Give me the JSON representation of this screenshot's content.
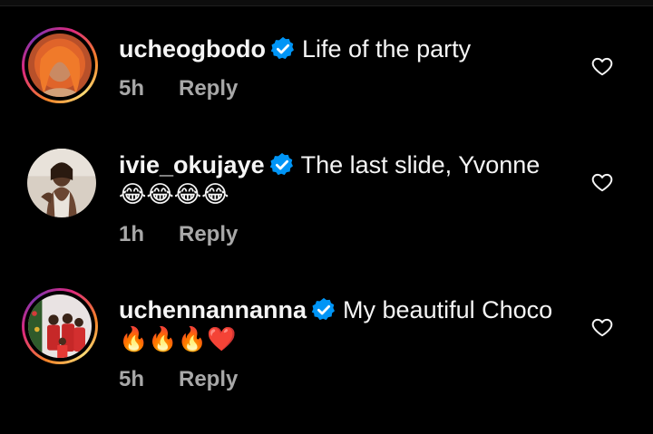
{
  "comments": [
    {
      "username": "ucheogbodo",
      "verified": true,
      "text": "Life of the party",
      "emojis": "",
      "time": "5h",
      "reply_label": "Reply",
      "has_story_ring": true
    },
    {
      "username": "ivie_okujaye",
      "verified": true,
      "text": "The last slide, Yvonne",
      "emojis": "😂😂😂😂",
      "time": "1h",
      "reply_label": "Reply",
      "has_story_ring": false
    },
    {
      "username": "uchennannanna",
      "verified": true,
      "text": "My beautiful Choco",
      "emojis": "🔥🔥🔥❤️",
      "time": "5h",
      "reply_label": "Reply",
      "has_story_ring": true
    }
  ],
  "colors": {
    "background": "#000000",
    "text_primary": "#f5f5f5",
    "text_secondary": "#a8a8a8",
    "verified_blue": "#0095f6",
    "story_ring_orange": "#f58529",
    "story_ring_pink": "#dd2a7b"
  },
  "icons": {
    "verified": "verified-badge-icon",
    "like": "heart-outline-icon"
  }
}
